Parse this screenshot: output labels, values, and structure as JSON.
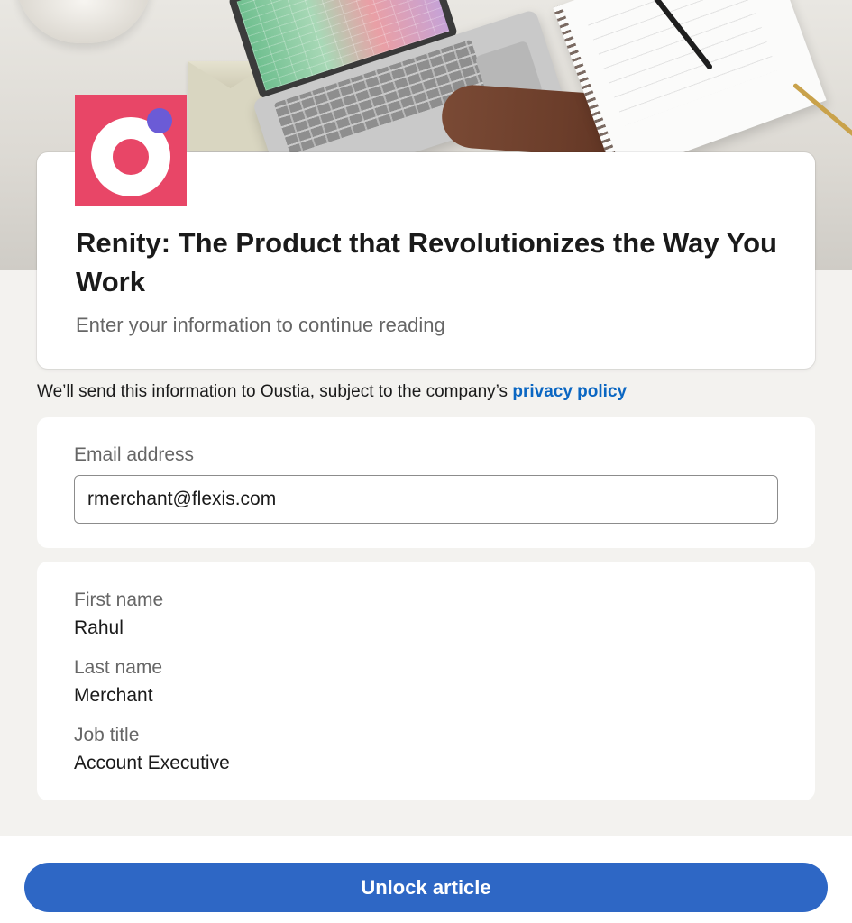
{
  "header": {
    "title": "Renity: The Product that Revolutionizes the Way You Work",
    "subtitle": "Enter your information to continue reading"
  },
  "logo": {
    "icon": "brand-logo-icon",
    "background_color": "#e84667",
    "dot_color": "#6b5bd6"
  },
  "notice": {
    "text": "We’ll send this information to Oustia, subject to the company’s ",
    "link_label": "privacy policy"
  },
  "form": {
    "email": {
      "label": "Email address",
      "value": "rmerchant@flexis.com"
    },
    "first_name": {
      "label": "First name",
      "value": "Rahul"
    },
    "last_name": {
      "label": "Last name",
      "value": "Merchant"
    },
    "job_title": {
      "label": "Job title",
      "value": "Account Executive"
    }
  },
  "actions": {
    "unlock_label": "Unlock article"
  },
  "colors": {
    "accent": "#2e67c5",
    "link": "#0a66c2",
    "page_background": "#f3f2ef"
  }
}
